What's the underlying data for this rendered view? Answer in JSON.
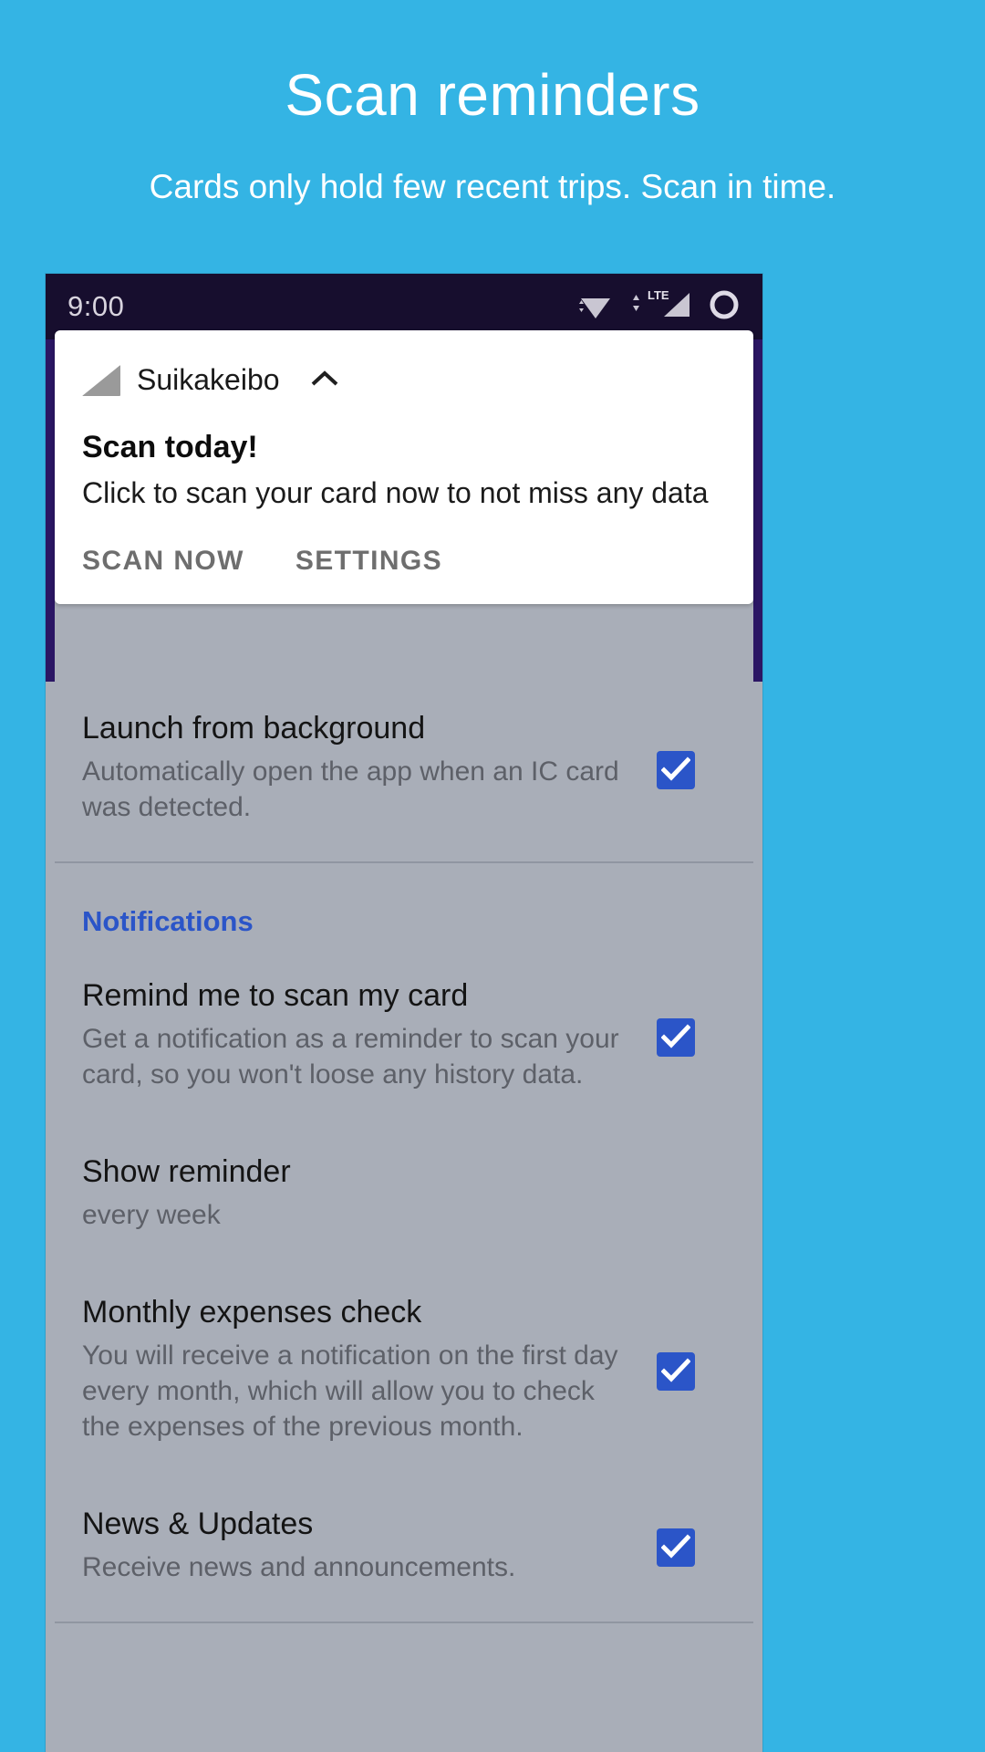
{
  "promo": {
    "title": "Scan reminders",
    "subtitle": "Cards only hold few recent trips. Scan in time.",
    "background_color": "#34b4e4",
    "text_color": "#ffffff"
  },
  "phone": {
    "statusbar": {
      "clock": "9:00",
      "background_color": "#170e2e",
      "icons": [
        "wifi-icon",
        "lte-signal-icon",
        "ring-icon"
      ],
      "lte_label": "LTE"
    },
    "notification": {
      "app_name": "Suikakeibo",
      "app_icon": "suikakeibo-app-icon",
      "collapse_icon": "chevron-up-icon",
      "title": "Scan today!",
      "body": "Click to scan your card now to not miss any data",
      "actions": [
        {
          "label": "SCAN NOW",
          "name": "scan-now-action"
        },
        {
          "label": "SETTINGS",
          "name": "settings-action"
        }
      ]
    },
    "settings": {
      "accent_color": "#2b55c8",
      "scrim_color": "#a9aeb8",
      "rows": [
        {
          "name": "launch-from-background",
          "title": "Launch from background",
          "desc": "Automatically open the app when an IC card was detected.",
          "checked": true
        }
      ],
      "section": {
        "label": "Notifications",
        "rows": [
          {
            "name": "remind-me-to-scan-my-card",
            "title": "Remind me to scan my card",
            "desc": "Get a notification as a reminder to scan your card, so you won't loose any history data.",
            "checked": true
          },
          {
            "name": "show-reminder",
            "title": "Show reminder",
            "desc": "every week",
            "checked": false
          },
          {
            "name": "monthly-expenses-check",
            "title": "Monthly expenses check",
            "desc": "You will receive a notification on the first day every month, which will allow you to check the expenses of the previous month.",
            "checked": true
          },
          {
            "name": "news-and-updates",
            "title": "News & Updates",
            "desc": "Receive news and announcements.",
            "checked": true
          }
        ]
      }
    }
  }
}
